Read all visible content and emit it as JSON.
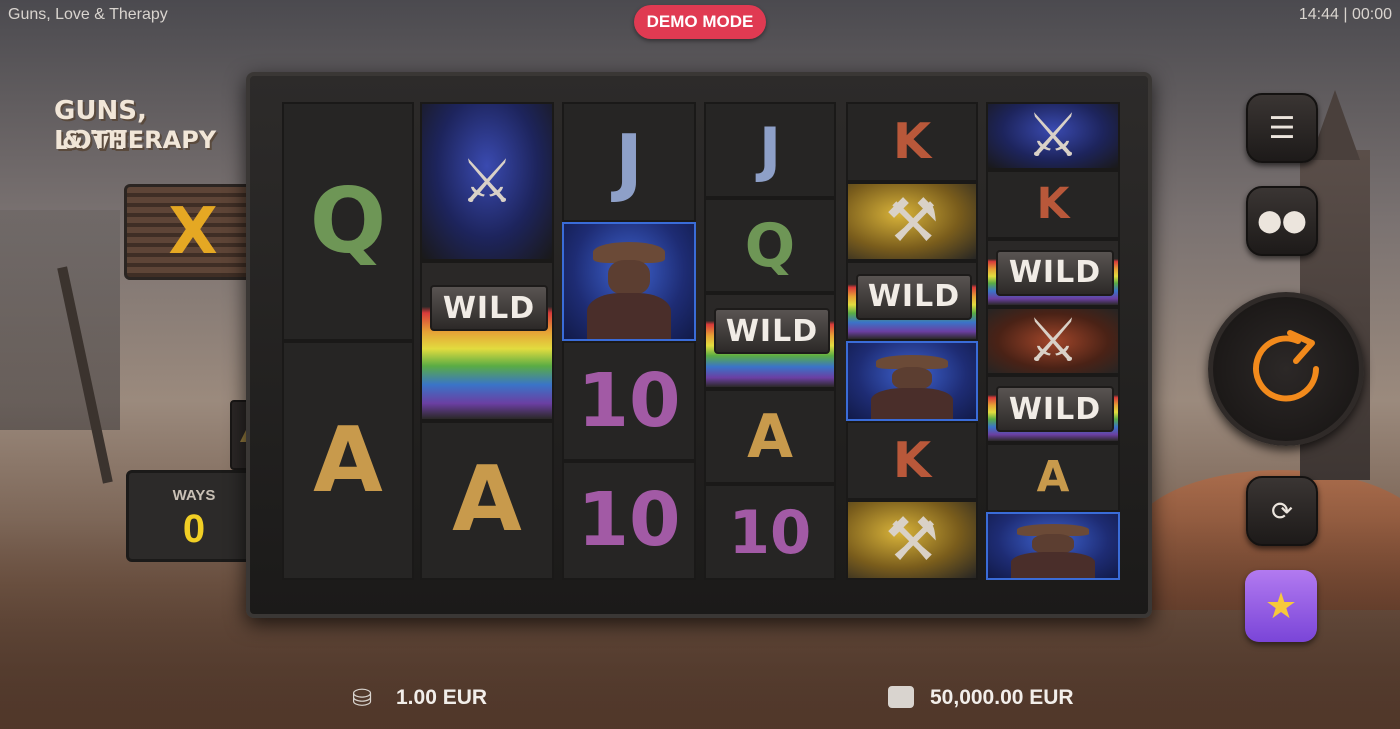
{
  "header": {
    "title": "Guns, Love & Therapy",
    "clock": "14:44 | 00:00",
    "demo_label": "DEMO MODE"
  },
  "logo": {
    "line1": "GUNS, LOVE",
    "line2": "& THERAPY"
  },
  "multiplier": {
    "symbol": "X"
  },
  "ways": {
    "label": "WAYS",
    "value": "0"
  },
  "reels": [
    [
      {
        "type": "letter",
        "text": "Q"
      },
      {
        "type": "letter",
        "text": "A"
      }
    ],
    [
      {
        "type": "revolver",
        "icon": "revolver-icon"
      },
      {
        "type": "wild",
        "text": "WILD"
      },
      {
        "type": "letter",
        "text": "A"
      }
    ],
    [
      {
        "type": "letter",
        "text": "J"
      },
      {
        "type": "cowboy",
        "icon": "cowboy-icon"
      },
      {
        "type": "letter",
        "text": "10"
      },
      {
        "type": "letter",
        "text": "10"
      }
    ],
    [
      {
        "type": "letter",
        "text": "J"
      },
      {
        "type": "letter",
        "text": "Q"
      },
      {
        "type": "wild",
        "text": "WILD"
      },
      {
        "type": "letter",
        "text": "A"
      },
      {
        "type": "letter",
        "text": "10"
      }
    ],
    [
      {
        "type": "letter",
        "text": "K"
      },
      {
        "type": "uzi",
        "icon": "uzi-icon"
      },
      {
        "type": "wild",
        "text": "WILD"
      },
      {
        "type": "cowboy",
        "icon": "cowboy-icon"
      },
      {
        "type": "letter",
        "text": "K"
      },
      {
        "type": "uzi",
        "icon": "uzi-icon"
      }
    ],
    [
      {
        "type": "revolver",
        "icon": "revolver-icon"
      },
      {
        "type": "letter",
        "text": "K"
      },
      {
        "type": "wild",
        "text": "WILD"
      },
      {
        "type": "shotgun",
        "icon": "shotgun-icon"
      },
      {
        "type": "wild",
        "text": "WILD"
      },
      {
        "type": "letter",
        "text": "A"
      },
      {
        "type": "cowboy",
        "icon": "cowboy-icon"
      }
    ]
  ],
  "controls": {
    "menu_icon": "menu-icon",
    "coins_icon": "coins-icon",
    "spin_icon": "spin-icon",
    "autoplay_icon": "autoplay-icon",
    "bonus_icon": "star-icon"
  },
  "footer": {
    "bet": "1.00 EUR",
    "balance": "50,000.00 EUR"
  }
}
